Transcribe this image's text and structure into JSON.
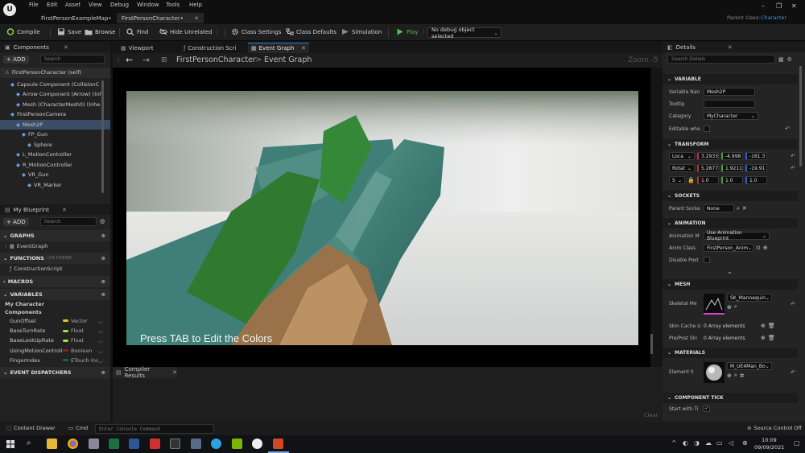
{
  "menu": {
    "items": [
      "File",
      "Edit",
      "Asset",
      "View",
      "Debug",
      "Window",
      "Tools",
      "Help"
    ]
  },
  "doc_tabs": [
    "FirstPersonExampleMap•",
    "FirstPersonCharacter•"
  ],
  "parent_class_label": "Parent class:",
  "parent_class_value": "Character",
  "toolbar": {
    "compile": "Compile",
    "save": "Save",
    "browse": "Browse",
    "find": "Find",
    "hide_unrelated": "Hide Unrelated",
    "class_settings": "Class Settings",
    "class_defaults": "Class Defaults",
    "simulation": "Simulation",
    "play": "Play",
    "debug_select": "No debug object selected"
  },
  "components": {
    "title": "Components",
    "add": "+ ADD",
    "search_placeholder": "Search",
    "root": "FirstPersonCharacter (self)",
    "items": [
      {
        "label": "Capsule Component (CollisionC",
        "indent": 1
      },
      {
        "label": "Arrow Component (Arrow) (Inh",
        "indent": 2
      },
      {
        "label": "Mesh (CharacterMesh0) (Inhe",
        "indent": 2
      },
      {
        "label": "FirstPersonCamera",
        "indent": 1
      },
      {
        "label": "Mesh2P",
        "indent": 2
      },
      {
        "label": "FP_Gun",
        "indent": 3
      },
      {
        "label": "Sphere",
        "indent": 4
      },
      {
        "label": "L_MotionController",
        "indent": 2
      },
      {
        "label": "R_MotionController",
        "indent": 2
      },
      {
        "label": "VR_Gun",
        "indent": 3
      },
      {
        "label": "VR_Marker",
        "indent": 4
      }
    ]
  },
  "my_blueprint": {
    "title": "My Blueprint",
    "add": "+ ADD",
    "search_placeholder": "Search",
    "graphs_label": "GRAPHS",
    "event_graph": "EventGraph",
    "functions_label": "FUNCTIONS",
    "functions_count": "(23 OVERR",
    "construction_script": "ConstructionScript",
    "macros_label": "MACROS",
    "variables_label": "VARIABLES",
    "my_character": "My Character",
    "components_cat": "Components",
    "variables": [
      {
        "name": "GunOffset",
        "type": "Vector",
        "color": "#f0c020"
      },
      {
        "name": "BaseTurnRate",
        "type": "Float",
        "color": "#9ee04a"
      },
      {
        "name": "BaseLookUpRate",
        "type": "Float",
        "color": "#9ee04a"
      },
      {
        "name": "UsingMotionControlle",
        "type": "Boolean",
        "color": "#9c1c1c"
      },
      {
        "name": "FingerIndex",
        "type": "ETouch Inc",
        "color": "#0a6a5a"
      }
    ],
    "event_dispatchers": "EVENT DISPATCHERS"
  },
  "graph_tabs": [
    "Viewport",
    "Construction Scri",
    "Event Graph"
  ],
  "breadcrumb": {
    "root": "FirstPersonCharacter",
    "sep": ">",
    "current": "Event Graph"
  },
  "zoom": "Zoom -5",
  "video_overlay": "Press TAB to Edit the Colors",
  "compiler_results": "Compiler Results",
  "clear": "Clear",
  "details": {
    "title": "Details",
    "search_placeholder": "Search Details",
    "variable_section": "VARIABLE",
    "variable_name_label": "Variable Nan",
    "variable_name": "Mesh2P",
    "tooltip_label": "Tooltip",
    "category_label": "Category",
    "category_value": "MyCharacter",
    "editable_label": "Editable whe",
    "transform_section": "TRANSFORM",
    "location_label": "Loca",
    "location": [
      "3.2933",
      "-4.998",
      "-161.3"
    ],
    "rotation_label": "Rotat",
    "rotation": [
      "5.2877",
      "1.9211",
      "-19.91"
    ],
    "scale_label": "S",
    "scale": [
      "1.0",
      "1.0",
      "1.0"
    ],
    "sockets_section": "SOCKETS",
    "parent_socket_label": "Parent Socke",
    "parent_socket_value": "None",
    "animation_section": "ANIMATION",
    "anim_mode_label": "Animation M",
    "anim_mode_value": "Use Animation Blueprint",
    "anim_class_label": "Anim Class",
    "anim_class_value": "FirstPerson_Anim",
    "disable_post_label": "Disable Post",
    "mesh_section": "MESH",
    "skeletal_mesh_label": "Skeletal Me",
    "skeletal_mesh_value": "SK_Mannequin",
    "skin_cache_label": "Skin Cache U",
    "skin_cache_value": "0 Array elements",
    "pre_post_label": "Pre/Post Ski",
    "pre_post_value": "0 Array elements",
    "materials_section": "MATERIALS",
    "element0_label": "Element 0",
    "element0_value": "M_UE4Man_Bo",
    "component_tick_section": "COMPONENT TICK",
    "start_with_tick_label": "Start with Ti"
  },
  "statusbar": {
    "content_drawer": "Content Drawer",
    "cmd": "Cmd",
    "console_placeholder": "Enter Console Command",
    "source_control": "Source Control Off"
  },
  "taskbar": {
    "time": "10:09",
    "date": "09/09/2021"
  },
  "colors": {
    "accent": "#2a84d6",
    "play": "#4ec24e",
    "selected_row": "#3a4d66"
  }
}
